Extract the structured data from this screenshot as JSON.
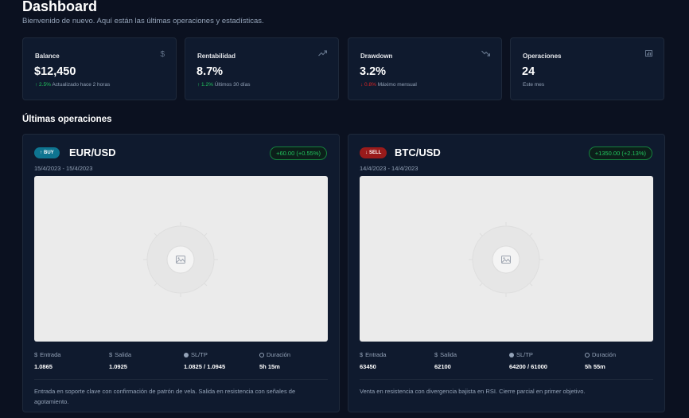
{
  "header": {
    "title": "Dashboard",
    "subtitle": "Bienvenido de nuevo. Aquí están las últimas operaciones y estadísticas."
  },
  "stats": [
    {
      "label": "Balance",
      "icon": "dollar-icon",
      "value": "$12,450",
      "delta": "↑ 2.5%",
      "delta_tone": "positive",
      "note": "Actualizado hace 2 horas"
    },
    {
      "label": "Rentabilidad",
      "icon": "trending-up-icon",
      "value": "8.7%",
      "delta": "↑ 1.2%",
      "delta_tone": "positive",
      "note": "Últimos 30 días"
    },
    {
      "label": "Drawdown",
      "icon": "trending-down-icon",
      "value": "3.2%",
      "delta": "↓ 0.8%",
      "delta_tone": "negative",
      "note": "Máximo mensual"
    },
    {
      "label": "Operaciones",
      "icon": "bar-chart-icon",
      "value": "24",
      "delta": "",
      "delta_tone": "",
      "note": "Este mes"
    }
  ],
  "section": {
    "title": "Últimas operaciones"
  },
  "metric_labels": {
    "entry": "Entrada",
    "exit": "Salida",
    "sltp": "SL/TP",
    "duration": "Duración"
  },
  "operations": [
    {
      "side": "BUY",
      "side_icon": "arrow-up-icon",
      "pair": "EUR/USD",
      "pnl": "+60.00 (+0.55%)",
      "dates": "15/4/2023 - 15/4/2023",
      "entry": "1.0865",
      "exit": "1.0925",
      "sltp": "1.0825 / 1.0945",
      "duration": "5h 15m",
      "note": "Entrada en soporte clave con confirmación de patrón de vela. Salida en resistencia con señales de agotamiento."
    },
    {
      "side": "SELL",
      "side_icon": "arrow-down-icon",
      "pair": "BTC/USD",
      "pnl": "+1350.00 (+2.13%)",
      "dates": "14/4/2023 - 14/4/2023",
      "entry": "63450",
      "exit": "62100",
      "sltp": "64200 / 61000",
      "duration": "5h 55m",
      "note": "Venta en resistencia con divergencia bajista en RSI. Cierre parcial en primer objetivo."
    }
  ],
  "colors": {
    "background": "#0b1120",
    "card": "#0f1a2e",
    "positive": "#22c55e",
    "negative": "#dc2626",
    "buy": "#0e7490",
    "sell": "#991b1b"
  }
}
